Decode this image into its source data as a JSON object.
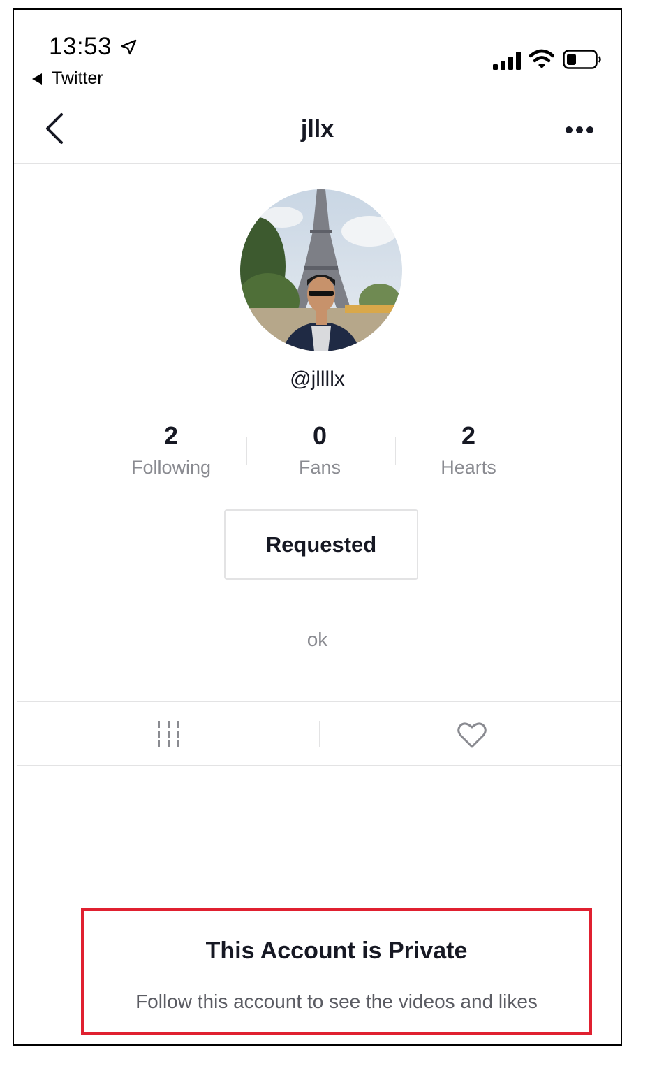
{
  "status_bar": {
    "time": "13:53",
    "back_app": "Twitter"
  },
  "nav": {
    "title": "jllx"
  },
  "profile": {
    "handle": "@jllllx",
    "avatar_description_icon": "avatar-photo"
  },
  "stats": [
    {
      "value": "2",
      "label": "Following"
    },
    {
      "value": "0",
      "label": "Fans"
    },
    {
      "value": "2",
      "label": "Hearts"
    }
  ],
  "actions": {
    "follow_state": "Requested"
  },
  "bio": "ok",
  "tabs": {
    "videos_icon": "grid-icon",
    "liked_icon": "heart-icon"
  },
  "private_notice": {
    "title": "This Account is Private",
    "subtitle": "Follow this account to see the videos and likes"
  },
  "colors": {
    "highlight_border": "#e02030",
    "text_primary": "#161823",
    "text_secondary": "#8a8b91"
  }
}
